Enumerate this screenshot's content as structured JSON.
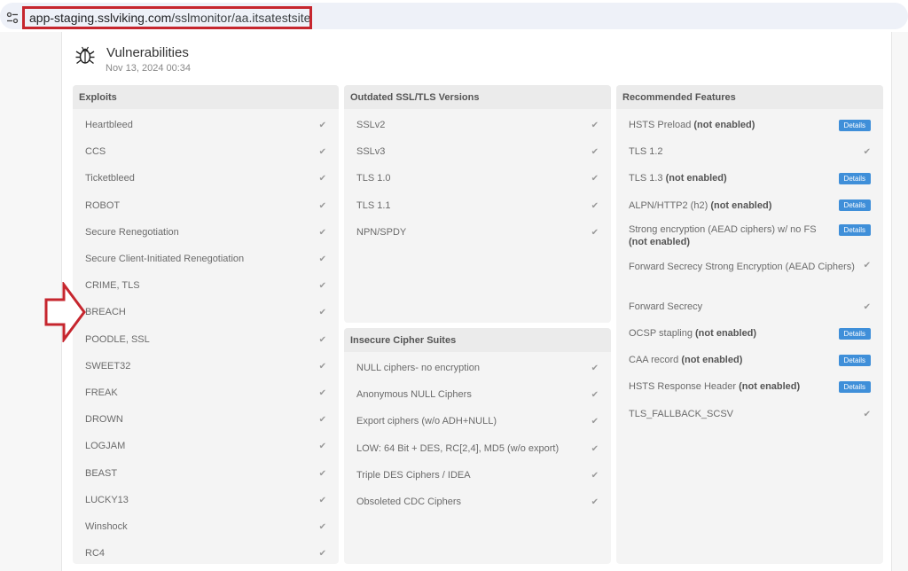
{
  "browser": {
    "url_host": "app-staging.sslviking.com",
    "url_path": "/sslmonitor/aa.itsatestsite.online"
  },
  "header": {
    "title": "Vulnerabilities",
    "date": "Nov 13, 2024 00:34"
  },
  "panels": {
    "exploits": {
      "title": "Exploits",
      "items": [
        {
          "label": "Heartbleed"
        },
        {
          "label": "CCS"
        },
        {
          "label": "Ticketbleed"
        },
        {
          "label": "ROBOT"
        },
        {
          "label": "Secure Renegotiation"
        },
        {
          "label": "Secure Client-Initiated Renegotiation"
        },
        {
          "label": "CRIME, TLS"
        },
        {
          "label": "BREACH"
        },
        {
          "label": "POODLE, SSL"
        },
        {
          "label": "SWEET32"
        },
        {
          "label": "FREAK"
        },
        {
          "label": "DROWN"
        },
        {
          "label": "LOGJAM"
        },
        {
          "label": "BEAST"
        },
        {
          "label": "LUCKY13"
        },
        {
          "label": "Winshock"
        },
        {
          "label": "RC4"
        }
      ]
    },
    "outdated": {
      "title": "Outdated SSL/TLS Versions",
      "items": [
        {
          "label": "SSLv2"
        },
        {
          "label": "SSLv3"
        },
        {
          "label": "TLS 1.0"
        },
        {
          "label": "TLS 1.1"
        },
        {
          "label": "NPN/SPDY"
        }
      ]
    },
    "insecure": {
      "title": "Insecure Cipher Suites",
      "items": [
        {
          "label": "NULL ciphers- no encryption"
        },
        {
          "label": "Anonymous NULL Ciphers"
        },
        {
          "label": "Export ciphers (w/o ADH+NULL)"
        },
        {
          "label": "LOW: 64 Bit + DES, RC[2,4], MD5 (w/o export)"
        },
        {
          "label": "Triple DES Ciphers / IDEA"
        },
        {
          "label": "Obsoleted CDC Ciphers"
        }
      ]
    },
    "recommended": {
      "title": "Recommended Features",
      "items": [
        {
          "label": "HSTS Preload",
          "note": "(not enabled)",
          "action": "Details"
        },
        {
          "label": "TLS 1.2",
          "note": "",
          "action": ""
        },
        {
          "label": "TLS 1.3",
          "note": "(not enabled)",
          "action": "Details"
        },
        {
          "label": "ALPN/HTTP2 (h2)",
          "note": "(not enabled)",
          "action": "Details"
        },
        {
          "label": "Strong encryption (AEAD ciphers) w/ no FS",
          "note": "(not enabled)",
          "action": "Details"
        },
        {
          "label": "Forward Secrecy Strong Encryption (AEAD Ciphers)",
          "note": "",
          "action": ""
        },
        {
          "label": "Forward Secrecy",
          "note": "",
          "action": ""
        },
        {
          "label": "OCSP stapling",
          "note": "(not enabled)",
          "action": "Details"
        },
        {
          "label": "CAA record",
          "note": "(not enabled)",
          "action": "Details"
        },
        {
          "label": "HSTS Response Header",
          "note": "(not enabled)",
          "action": "Details"
        },
        {
          "label": "TLS_FALLBACK_SCSV",
          "note": "",
          "action": ""
        }
      ]
    }
  },
  "icons": {
    "site_info": "tune-icon",
    "header": "bug-icon",
    "check": "checkmark-icon",
    "annotation": "arrow-right-icon"
  },
  "colors": {
    "annotation_red": "#c6262e",
    "details_blue": "#3f8fd9",
    "panel_bg": "#f4f4f4",
    "panel_header_bg": "#ebebeb"
  }
}
